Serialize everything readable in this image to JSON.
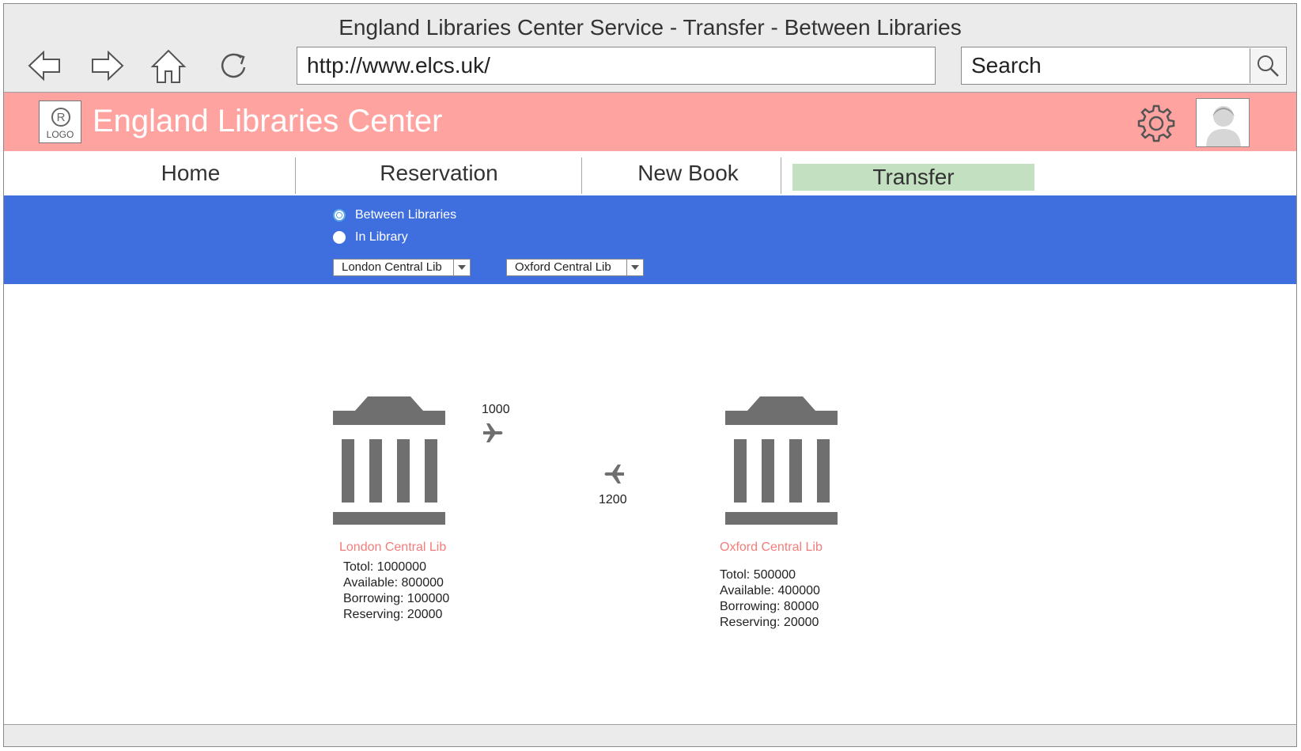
{
  "window": {
    "title": "England Libraries Center Service - Transfer - Between Libraries"
  },
  "toolbar": {
    "back_icon": "arrow-left-icon",
    "forward_icon": "arrow-right-icon",
    "home_icon": "home-icon",
    "reload_icon": "reload-icon",
    "url": "http://www.elcs.uk/",
    "search_placeholder": "Search",
    "search_icon": "magnifier-icon"
  },
  "header": {
    "logo_text": "LOGO",
    "brand": "England Libraries Center",
    "settings_icon": "gear-icon",
    "avatar_icon": "user-avatar-icon",
    "bg_color": "#ffa3a0"
  },
  "menu": {
    "items": [
      {
        "label": "Home"
      },
      {
        "label": "Reservation"
      },
      {
        "label": "New Book"
      },
      {
        "label": "Transfer",
        "active": true
      }
    ],
    "active_color": "#c3e0c0"
  },
  "subbar": {
    "bg_color": "#3f6fdf",
    "radios": [
      {
        "label": "Between Libraries",
        "checked": true
      },
      {
        "label": "In Library",
        "checked": false
      }
    ],
    "from_select": "London Central Lib",
    "to_select": "Oxford Central Lib"
  },
  "transfer": {
    "outgoing_count": "1000",
    "incoming_count": "1200",
    "libraries": [
      {
        "name": "London Central Lib",
        "stats": [
          "Totol: 1000000",
          "Available: 800000",
          "Borrowing: 100000",
          "Reserving: 20000"
        ]
      },
      {
        "name": "Oxford Central Lib",
        "stats": [
          "Totol: 500000",
          "Available: 400000",
          "Borrowing: 80000",
          "Reserving: 20000"
        ]
      }
    ]
  }
}
